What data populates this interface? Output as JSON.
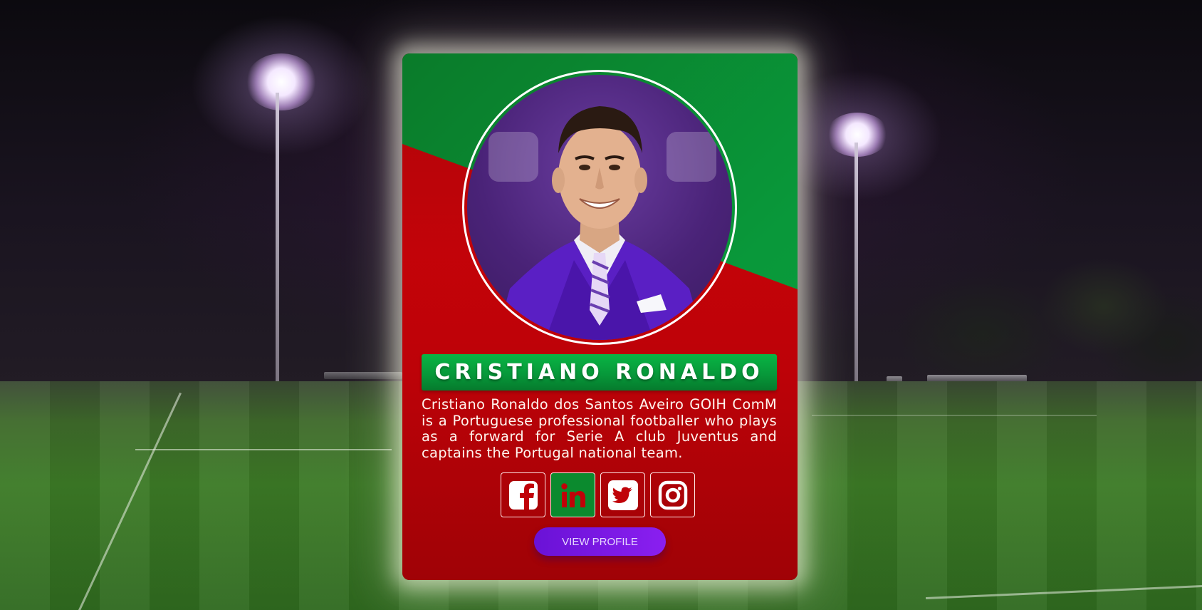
{
  "card": {
    "name": "CRISTIANO RONALDO",
    "bio": "Cristiano Ronaldo dos Santos Aveiro GOIH ComM is a Portuguese professional footballer who plays as a forward for Serie A club Juventus and captains the Portugal national team.",
    "button_label": "VIEW PROFILE",
    "socials": [
      {
        "icon": "facebook-icon",
        "active": false
      },
      {
        "icon": "linkedin-icon",
        "active": true
      },
      {
        "icon": "twitter-icon",
        "active": false
      },
      {
        "icon": "instagram-icon",
        "active": false
      }
    ]
  },
  "colors": {
    "card_red": "#c00208",
    "card_green": "#09983a",
    "name_bar_green": "#07993a",
    "active_social_bg": "#0b8a2e",
    "button_purple": "#7a18e4",
    "glow": "#fffbe8"
  }
}
